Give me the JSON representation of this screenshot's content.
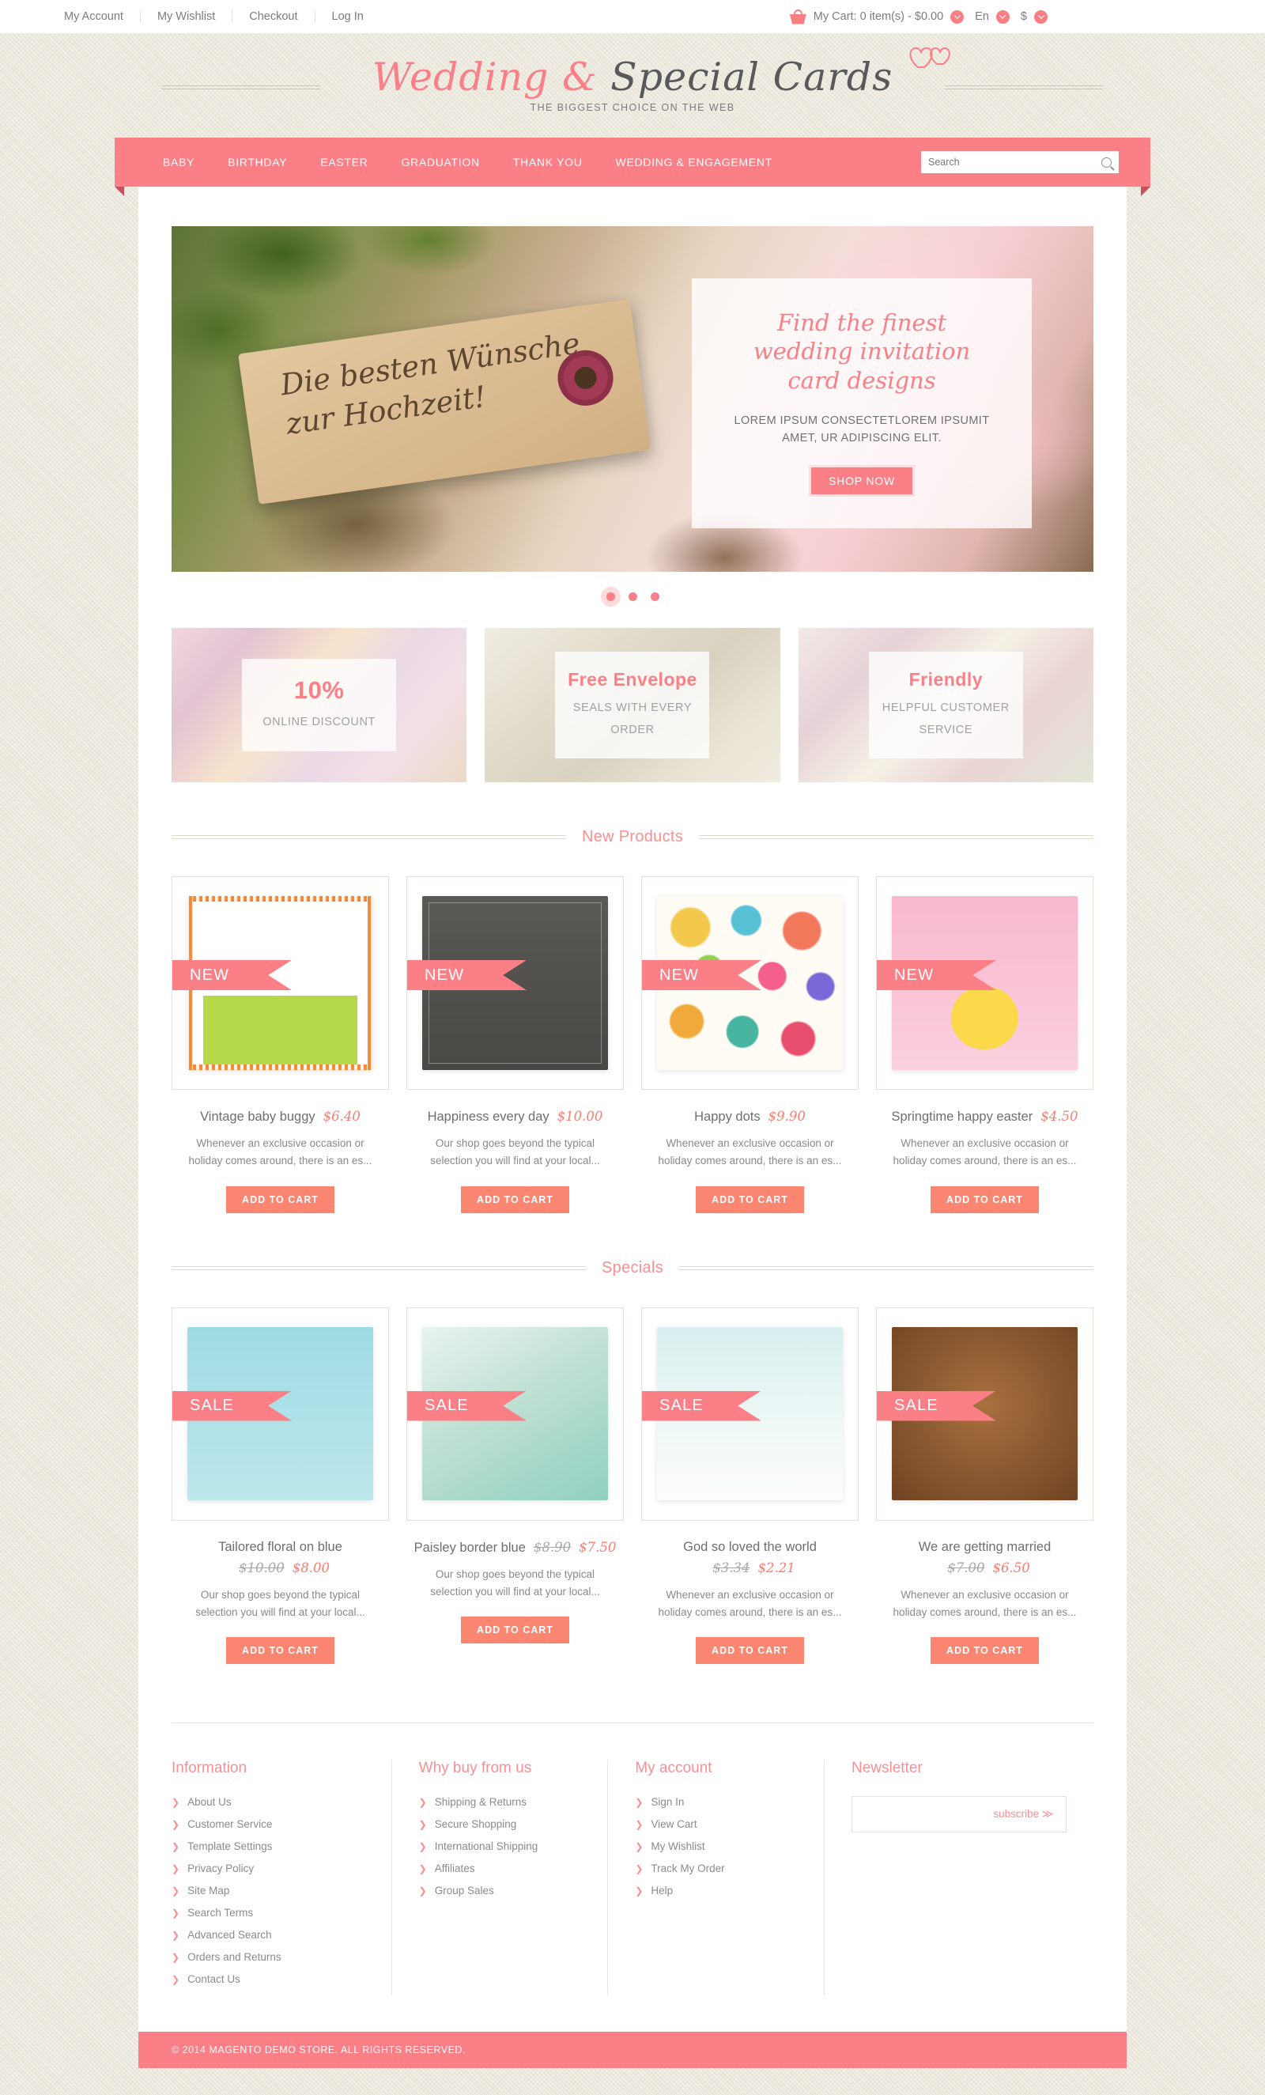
{
  "topbar": {
    "links": [
      "My Account",
      "My Wishlist",
      "Checkout",
      "Log In"
    ],
    "cart_icon": "shopping-basket-icon",
    "cart_text": "My Cart: 0 item(s) - $0.00",
    "language": "En",
    "currency": "$"
  },
  "header": {
    "logo_pink": "Wedding &",
    "logo_dark": "Special Cards",
    "tagline": "THE BIGGEST  CHOICE ON THE WEB",
    "hearts_icon": "double-hearts-icon"
  },
  "nav": {
    "items": [
      "BABY",
      "BIRTHDAY",
      "EASTER",
      "GRADUATION",
      "THANK YOU",
      "WEDDING & ENGAGEMENT"
    ],
    "search_placeholder": "Search",
    "search_value": "",
    "search_icon": "search-icon"
  },
  "hero": {
    "tag_text": "Die besten Wünsche zur Hochzeit!",
    "title": "Find the finest wedding invitation card designs",
    "subtitle": "LOREM IPSUM CONSECTETLOREM IPSUMIT AMET, UR ADIPISCING ELIT.",
    "button": "SHOP NOW",
    "dots": 3,
    "active_dot": 0
  },
  "promos": [
    {
      "big": "10%",
      "small": "ONLINE DISCOUNT",
      "name": "promo-discount"
    },
    {
      "big": "Free Envelope",
      "small": "SEALS WITH EVERY ORDER",
      "name": "promo-envelope"
    },
    {
      "big": "Friendly",
      "small": "HELPFUL CUSTOMER SERVICE",
      "name": "promo-service"
    }
  ],
  "new_products": {
    "title": "New Products",
    "items": [
      {
        "name": "Vintage baby buggy",
        "price": "$6.40",
        "old_price": "",
        "desc": "Whenever an exclusive occasion or holiday comes around, there is an es...",
        "badge": "NEW",
        "button": "ADD TO CART",
        "art": "art-baby"
      },
      {
        "name": "Happiness every day",
        "price": "$10.00",
        "old_price": "",
        "desc": "Our shop goes beyond the typical selection you will find at your local...",
        "badge": "NEW",
        "button": "ADD TO CART",
        "art": "art-happy"
      },
      {
        "name": "Happy dots",
        "price": "$9.90",
        "old_price": "",
        "desc": "Whenever an exclusive occasion or holiday comes around, there is an es...",
        "badge": "NEW",
        "button": "ADD TO CART",
        "art": "art-dots"
      },
      {
        "name": "Springtime happy easter",
        "price": "$4.50",
        "old_price": "",
        "desc": "Whenever an exclusive occasion or holiday comes around, there is an es...",
        "badge": "NEW",
        "button": "ADD TO CART",
        "art": "art-easter"
      }
    ]
  },
  "specials": {
    "title": "Specials",
    "items": [
      {
        "name": "Tailored floral on blue",
        "price": "$8.00",
        "old_price": "$10.00",
        "price_below": true,
        "desc": "Our shop goes beyond the typical selection you will find at your local...",
        "badge": "SALE",
        "button": "ADD TO CART",
        "art": "art-floral"
      },
      {
        "name": "Paisley border blue",
        "price": "$7.50",
        "old_price": "$8.90",
        "price_below": false,
        "desc": "Our shop goes beyond the typical selection you will find at your local...",
        "badge": "SALE",
        "button": "ADD TO CART",
        "art": "art-paisley"
      },
      {
        "name": "God so loved the world",
        "price": "$2.21",
        "old_price": "$3.34",
        "price_below": true,
        "desc": "Whenever an exclusive occasion or holiday comes around, there is an es...",
        "badge": "SALE",
        "button": "ADD TO CART",
        "art": "art-bird"
      },
      {
        "name": "We are getting married",
        "price": "$6.50",
        "old_price": "$7.00",
        "price_below": true,
        "desc": "Whenever an exclusive occasion or holiday comes around, there is an es...",
        "badge": "SALE",
        "button": "ADD TO CART",
        "art": "art-wood"
      }
    ]
  },
  "footer": {
    "columns": [
      {
        "heading": "Information",
        "links": [
          "About Us",
          "Customer Service",
          "Template Settings",
          "Privacy Policy",
          "Site Map",
          "Search Terms",
          "Advanced Search",
          "Orders and Returns",
          "Contact Us"
        ]
      },
      {
        "heading": "Why buy from us",
        "links": [
          "Shipping & Returns",
          "Secure Shopping",
          "International Shipping",
          "Affiliates",
          "Group Sales"
        ]
      },
      {
        "heading": "My account",
        "links": [
          "Sign In",
          "View Cart",
          "My Wishlist",
          "Track My Order",
          "Help"
        ]
      }
    ],
    "newsletter": {
      "heading": "Newsletter",
      "placeholder": "",
      "value": "",
      "subscribe": "subscribe  ≫"
    },
    "copyright": "© 2014 MAGENTO DEMO STORE. ALL RIGHTS RESERVED."
  },
  "colors": {
    "accent": "#fa7f86",
    "accent_dark": "#c7505a",
    "button": "#fa8570",
    "bg": "#ece8dd",
    "text": "#6c6e70"
  }
}
